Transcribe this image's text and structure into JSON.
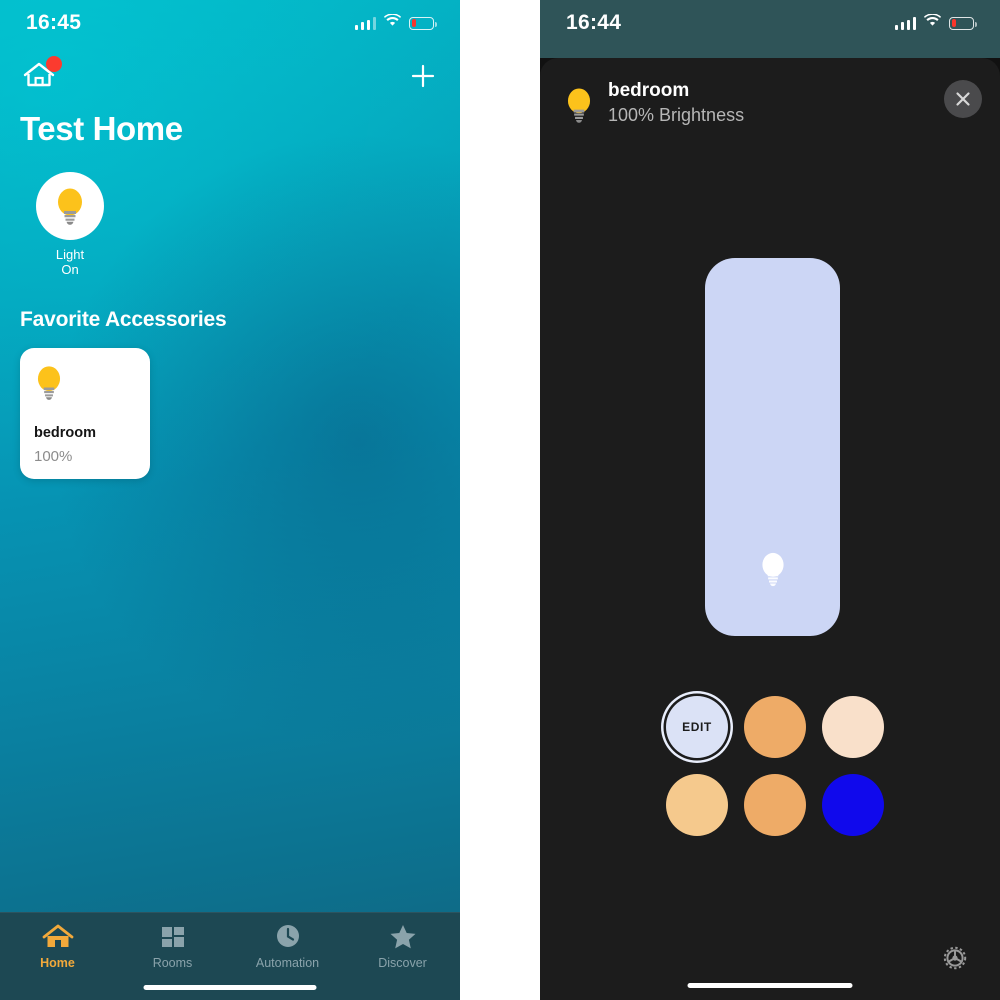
{
  "left": {
    "status_bar": {
      "time": "16:45",
      "cellular": "signal-bars-icon",
      "wifi": "wifi-icon",
      "battery": "battery-low-icon"
    },
    "header": {
      "home_icon": "home-icon",
      "notification_badge": "red-dot-badge",
      "add_label": "+"
    },
    "title": "Test Home",
    "status_accessory": {
      "icon": "lightbulb-icon",
      "name": "Light",
      "state": "On"
    },
    "section_title": "Favorite Accessories",
    "favorites": [
      {
        "icon": "lightbulb-icon",
        "name": "bedroom",
        "value": "100%"
      }
    ],
    "tabs": [
      {
        "label": "Home",
        "icon": "home-icon",
        "active": true
      },
      {
        "label": "Rooms",
        "icon": "rooms-icon",
        "active": false
      },
      {
        "label": "Automation",
        "icon": "clock-check-icon",
        "active": false
      },
      {
        "label": "Discover",
        "icon": "star-icon",
        "active": false
      }
    ]
  },
  "right": {
    "status_bar": {
      "time": "16:44",
      "cellular": "signal-bars-icon",
      "wifi": "wifi-icon",
      "battery": "battery-low-icon"
    },
    "sheet": {
      "icon": "lightbulb-icon",
      "title": "bedroom",
      "subtitle": "100% Brightness",
      "close_label": "close-icon"
    },
    "brightness": {
      "percent": 100,
      "fill_color": "#ccd6f5",
      "handle_icon": "lightbulb-icon"
    },
    "swatches": [
      {
        "name": "edit",
        "label": "EDIT",
        "color": "#dbe2f6",
        "selected": true
      },
      {
        "name": "swatch-2",
        "label": "",
        "color": "#eeab67",
        "selected": false
      },
      {
        "name": "swatch-3",
        "label": "",
        "color": "#f9e0ca",
        "selected": false
      },
      {
        "name": "swatch-4",
        "label": "",
        "color": "#f5c98d",
        "selected": false
      },
      {
        "name": "swatch-5",
        "label": "",
        "color": "#eeab67",
        "selected": false
      },
      {
        "name": "swatch-6",
        "label": "",
        "color": "#1009ec",
        "selected": false
      }
    ],
    "settings_icon": "gear-icon"
  },
  "colors": {
    "accent": "#f2a93b",
    "sheet_bg": "#1c1c1c",
    "slider_fill": "#ccd6f5",
    "badge_red": "#fb3b2f"
  }
}
